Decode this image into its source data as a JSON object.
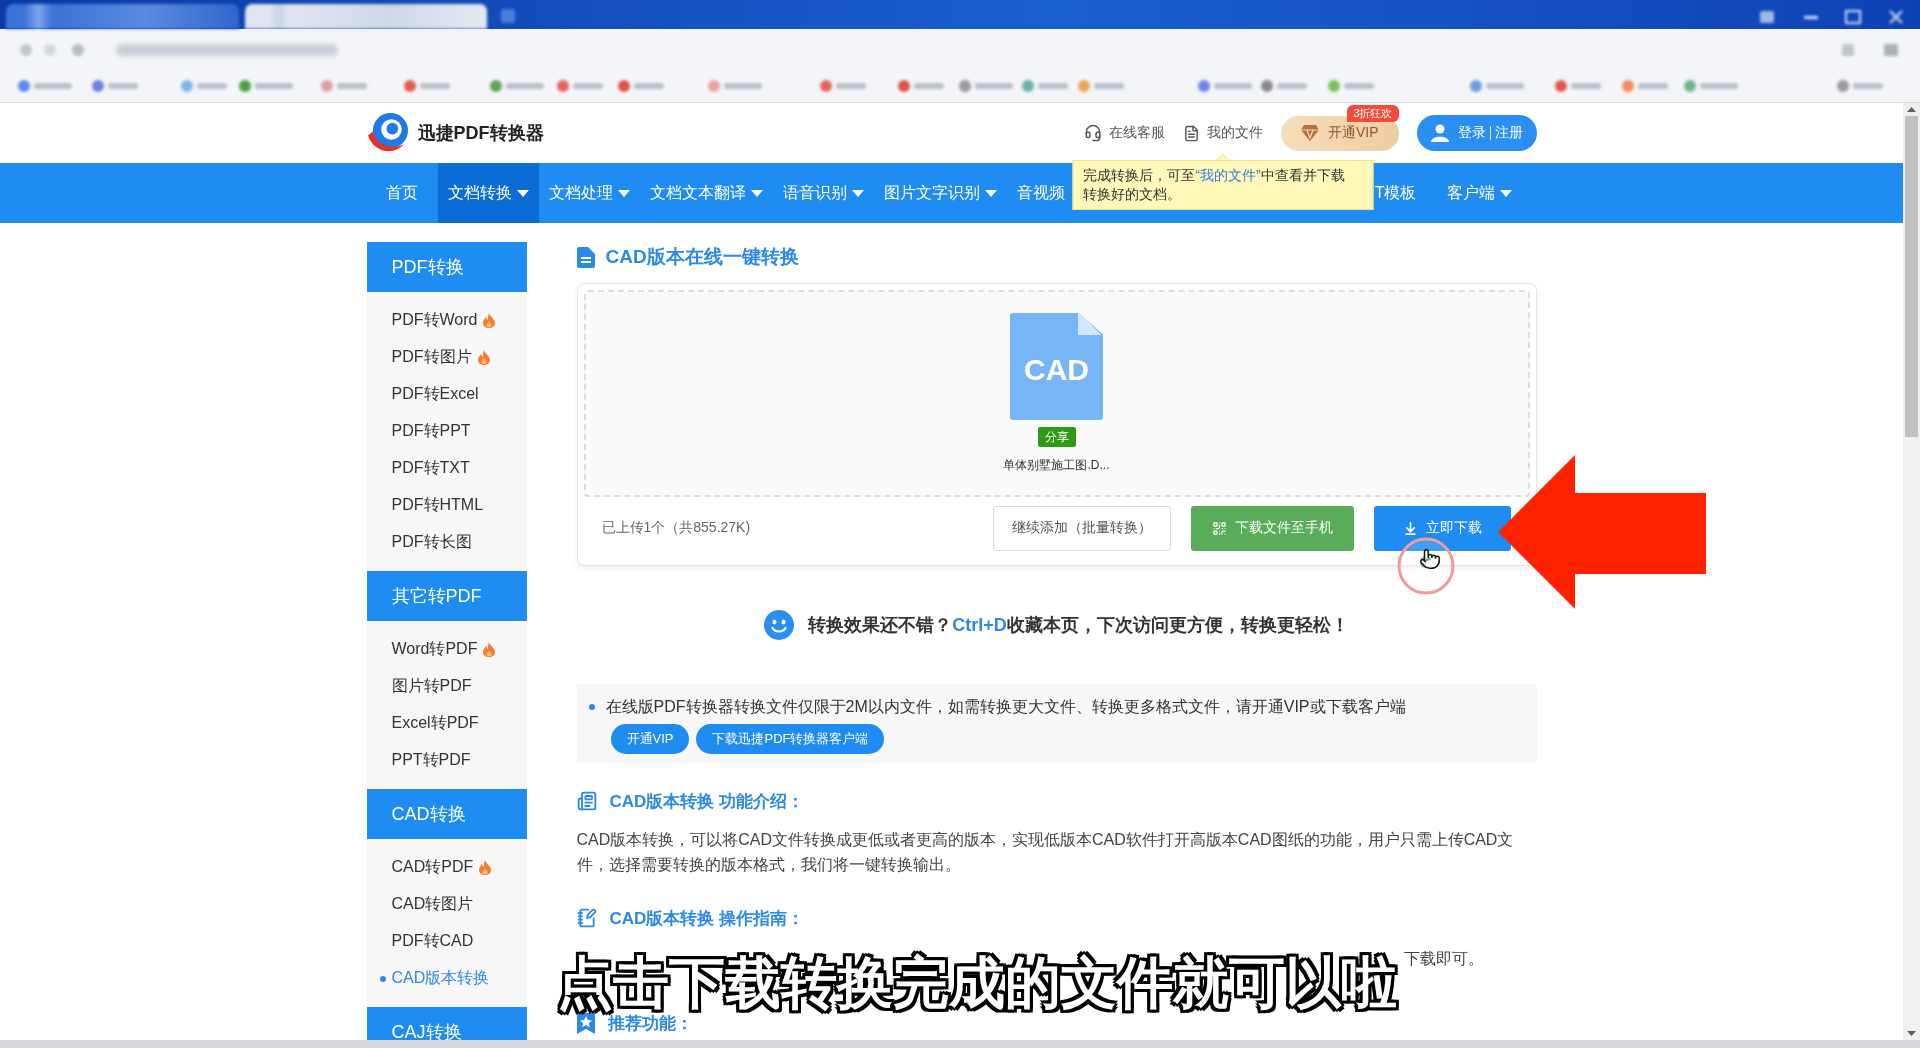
{
  "header": {
    "brand": "迅捷PDF转换器",
    "links": [
      {
        "kind": "service",
        "label": "在线客服"
      },
      {
        "kind": "files",
        "label": "我的文件",
        "tooltip": {
          "before": "完成转换后，可至",
          "link": "“我的文件”",
          "after": "中查看并下载转换好的文档。"
        }
      }
    ],
    "vip_button": {
      "label": "开通VIP",
      "badge": "3折狂欢"
    },
    "account": [
      "登录",
      "注册"
    ]
  },
  "nav": {
    "items": [
      {
        "label": "首页",
        "dropdown": false,
        "selected": false
      },
      {
        "label": "文档转换",
        "dropdown": true,
        "selected": true
      },
      {
        "label": "文档处理",
        "dropdown": true,
        "selected": false
      },
      {
        "label": "文档文本翻译",
        "dropdown": true,
        "selected": false
      },
      {
        "label": "语音识别",
        "dropdown": true,
        "selected": false
      },
      {
        "label": "图片文字识别",
        "dropdown": true,
        "selected": false
      },
      {
        "label": "音视频",
        "dropdown": false,
        "selected": false
      }
    ],
    "trailing_items": [
      {
        "label": "T模板",
        "dropdown": false,
        "selected": false
      },
      {
        "label": "客户端",
        "dropdown": true,
        "selected": false
      }
    ]
  },
  "sidebar": {
    "groups": [
      {
        "title": "PDF转换",
        "items": [
          {
            "label": "PDF转Word",
            "hot": true,
            "selected": false
          },
          {
            "label": "PDF转图片",
            "hot": true,
            "selected": false
          },
          {
            "label": "PDF转Excel",
            "hot": false,
            "selected": false
          },
          {
            "label": "PDF转PPT",
            "hot": false,
            "selected": false
          },
          {
            "label": "PDF转TXT",
            "hot": false,
            "selected": false
          },
          {
            "label": "PDF转HTML",
            "hot": false,
            "selected": false
          },
          {
            "label": "PDF转长图",
            "hot": false,
            "selected": false
          }
        ]
      },
      {
        "title": "其它转PDF",
        "items": [
          {
            "label": "Word转PDF",
            "hot": true,
            "selected": false
          },
          {
            "label": "图片转PDF",
            "hot": false,
            "selected": false
          },
          {
            "label": "Excel转PDF",
            "hot": false,
            "selected": false
          },
          {
            "label": "PPT转PDF",
            "hot": false,
            "selected": false
          }
        ]
      },
      {
        "title": "CAD转换",
        "items": [
          {
            "label": "CAD转PDF",
            "hot": true,
            "selected": false
          },
          {
            "label": "CAD转图片",
            "hot": false,
            "selected": false
          },
          {
            "label": "PDF转CAD",
            "hot": false,
            "selected": false
          },
          {
            "label": "CAD版本转换",
            "hot": false,
            "selected": true
          }
        ]
      },
      {
        "title": "CAJ转换"
      }
    ]
  },
  "main": {
    "title": "CAD版本在线一键转换",
    "upload": {
      "file": {
        "type_label": "CAD",
        "tag": "分享",
        "name": "单体别墅施工图.D..."
      },
      "status": "已上传1个（共855.27K)",
      "buttons": [
        {
          "kind": "outline",
          "label": "继续添加（批量转换）"
        },
        {
          "kind": "phone",
          "label": "下载文件至手机"
        },
        {
          "kind": "download",
          "label": "立即下载"
        }
      ]
    },
    "favorite_tip": {
      "before": "转换效果还不错？",
      "highlight": "Ctrl+D",
      "after": "收藏本页，下次访问更方便，转换更轻松！"
    },
    "notice": {
      "text": "在线版PDF转换器转换文件仅限于2M以内文件，如需转换更大文件、转换更多格式文件，请开通VIP或下载客户端",
      "buttons": [
        "开通VIP",
        "下载迅捷PDF转换器客户端"
      ]
    },
    "sections": [
      {
        "kind": "intro",
        "title": "CAD版本转换 功能介绍：",
        "text": "CAD版本转换，可以将CAD文件转换成更低或者更高的版本，实现低版本CAD软件打开高版本CAD图纸的功能，用户只需上传CAD文件，选择需要转换的版本格式，我们将一键转换输出。"
      },
      {
        "kind": "guide",
        "title": "CAD版本转换 操作指南：",
        "text": "下载即可。"
      },
      {
        "kind": "recommend",
        "title": "推荐功能："
      }
    ]
  },
  "caption": "点击下载转换完成的文件就可以啦"
}
